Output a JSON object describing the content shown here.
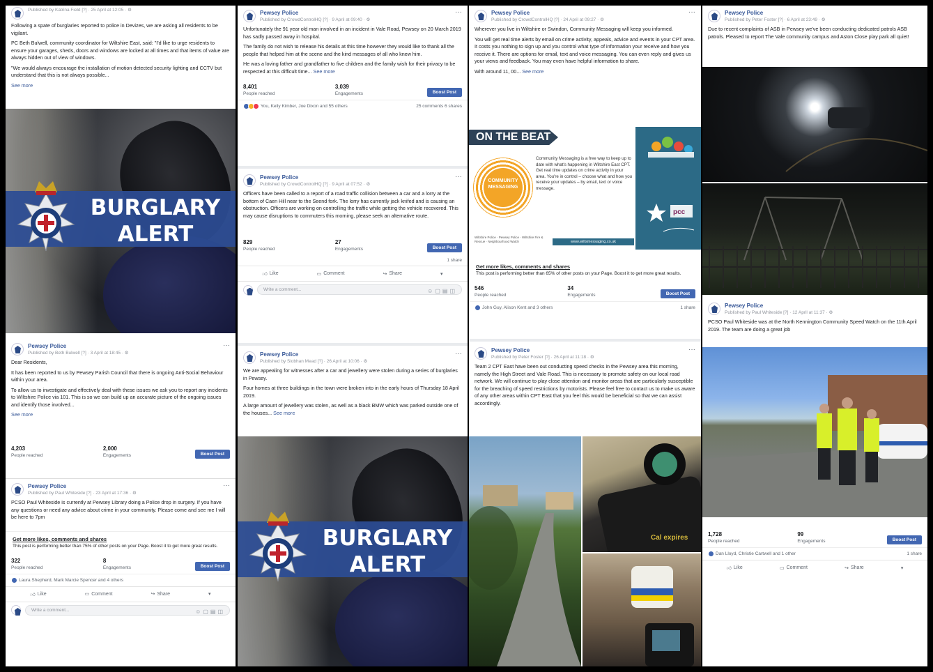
{
  "page_name": "Pewsey Police",
  "boost_label": "Boost Post",
  "like_label": "Like",
  "comment_label": "Comment",
  "share_label": "Share",
  "write_comment": "Write a comment...",
  "see_more": "See more",
  "people_reached_label": "People reached",
  "engagements_label": "Engagements",
  "promo_title": "Get more likes, comments and shares",
  "burglary": {
    "line1": "BURGLARY",
    "line2": "ALERT"
  },
  "col1": {
    "post1": {
      "byline": "Published by Katrina Field [?] · 25 April at 12:05 · ⚙",
      "text1": "Following a spate of burglaries reported to police in Devizes, we are asking all residents to be vigilant.",
      "text2": "PC Beth Bulwell, community coordinator for Wiltshire East, said: \"I'd like to urge residents to ensure your garages, sheds, doors and windows are locked at all times and that items of value are always hidden out of view of windows.",
      "text3": "\"We would always encourage the installation of motion detected security lighting and CCTV but understand that this is not always possible..."
    },
    "post2": {
      "byline": "Published by Beth Bulwell [?] · 3 April at 18:45 · ⚙",
      "text1": "Dear Residents,",
      "text2": "It has been reported to us by Pewsey Parish Council that there is ongoing Anti-Social Behaviour within your area.",
      "text3": "To allow us to investigate and effectively deal with these issues we ask you to report any incidents to Wiltshire Police via 101. This is so we can build up an accurate picture of the ongoing issues and identify those involved...",
      "reached": "4,203",
      "engagements": "2,000"
    },
    "post3": {
      "byline": "Published by Paul Whiteside [?] · 23 April at 17:36 · ⚙",
      "text": "PCSO Paul Whiteside is currently at Pewsey Library doing a Police drop in surgery. If you have any questions or need any advice about crime in your community. Please come and see me I will be here to 7pm",
      "promo_text": "This post is performing better than 75% of other posts on your Page. Boost it to get more great results.",
      "reached": "322",
      "engagements": "8",
      "reactions": "Laura Shepherd, Mark Marcie Spencer and 4 others"
    }
  },
  "col2": {
    "post1": {
      "byline": "Published by CrowdControlHQ [?] · 9 April at 09:40 · ⚙",
      "text1": "Unfortunately the 91 year old man involved in an incident in Vale Road, Pewsey on 20 March 2019 has sadly passed away in hospital.",
      "text2": "The family do not wish to release his details at this time however they would like to thank all the people that helped him at the scene and the kind messages of all who knew him.",
      "text3": "He was a loving father and grandfather to five children and the family wish for their privacy to be respected at this difficult time...",
      "reached": "8,401",
      "engagements": "3,039",
      "reactions": "You, Kelly Kimber, Joe Dixon and 55 others",
      "counts": "25 comments 6 shares"
    },
    "post2": {
      "byline": "Published by CrowdControlHQ [?] · 9 April at 07:52 · ⚙",
      "text": "Officers have been called to a report of a road traffic collision between a car and a lorry at the bottom of Caen Hill near to the Seend fork. The lorry has currently jack knifed and is causing an obstruction. Officers are working on controlling the traffic while getting the vehicle recovered. This may cause disruptions to commuters this morning, please seek an alternative route.",
      "reached": "829",
      "engagements": "27",
      "shares": "1 share"
    },
    "post3": {
      "byline": "Published by Siobhan Mead [?] · 26 April at 10:06 · ⚙",
      "text1": "We are appealing for witnesses after a car and jewellery were stolen during a series of burglaries in Pewsey.",
      "text2": "Four homes at three buildings in the town were broken into in the early hours of Thursday 18 April 2019.",
      "text3": "A large amount of jewellery was stolen, as well as a black BMW which was parked outside one of the houses..."
    }
  },
  "col3": {
    "post1": {
      "byline": "Published by CrowdControlHQ [?] · 24 April at 09:27 · ⚙",
      "text1": "Wherever you live in Wiltshire or Swindon, Community Messaging will keep you informed.",
      "text2": "You will get real time alerts by email on crime activity, appeals, advice and events in your CPT area. It costs you nothing to sign up and you control what type of information your receive and how you receive it. There are options for email, text and voice messaging. You can even reply and gives us your views and feedback. You may even have helpful information to share.",
      "text3": "With around 11, 00..."
    },
    "otb": {
      "tag": "ON THE BEAT",
      "circle": "COMMUNITY MESSAGING",
      "text": "Community Messaging is a free way to keep up to date with what's happening in Wiltshire East CPT. Get real time updates on crime activity in your area. You're in control – choose what and how you receive your updates – by email, text or voice message.",
      "footer": "www.wiltsmessaging.co.uk",
      "small": "Wiltshire Police · Pewsey Police · Wiltshire Fire & Rescue · Neighbourhood Watch"
    },
    "promo": {
      "text": "This post is performing better than 65% of other posts on your Page. Boost it to get more great results.",
      "reached": "546",
      "engagements": "34",
      "reactions": "John Guy, Alison Kent and 3 others",
      "shares": "1 share"
    },
    "post2": {
      "byline": "Published by Peter Foster [?] · 26 April at 11:18 · ⚙",
      "text": "Team 2 CPT East have been out conducting speed checks in the Pewsey area this morning, namely the High Street and Vale Road. This is necessary to promote safety on our local road network. We will continue to play close attention and monitor areas that are particularly susceptible for the breaching of speed restrictions by motorists. Please feel free to contact us to make us aware of any other areas within CPT East that you feel this would be beneficial so that we can assist accordingly."
    }
  },
  "col4": {
    "post1": {
      "byline": "Published by Peter Foster [?] · 6 April at 23:49 · ⚙",
      "text": "Due to recent complaints of ASB in Pewsey we've been conducting dedicated patrols ASB patrols. Pleased to report The Vale community campus and Aston Close play park all quiet!"
    },
    "post2": {
      "byline": "Published by Paul Whiteside [?] · 12 April at 11:37 · ⚙",
      "text": "PCSO Paul Whiteside was at the North Kennington Community Speed Watch on the 11th April 2019. The team are doing a great job",
      "reached": "1,728",
      "engagements": "99",
      "reactions": "Dan Lloyd, Christie Cartwell and 1 other",
      "shares": "1 share"
    }
  }
}
